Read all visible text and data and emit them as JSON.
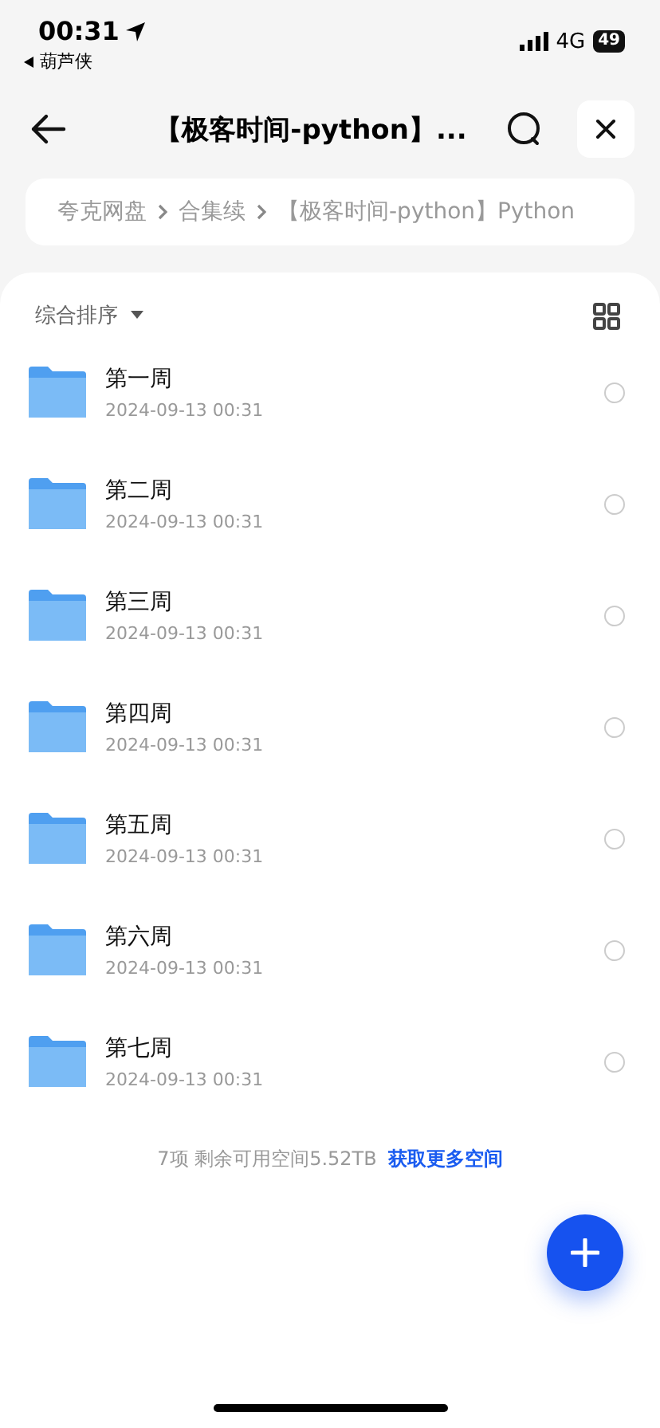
{
  "status_bar": {
    "time": "00:31",
    "back_app": "葫芦侠",
    "network": "4G",
    "battery": "49"
  },
  "header": {
    "title": "【极客时间-python】..."
  },
  "breadcrumb": [
    "夸克网盘",
    "合集续",
    "【极客时间-python】Python"
  ],
  "sort": {
    "label": "综合排序"
  },
  "items": [
    {
      "name": "第一周",
      "date": "2024-09-13 00:31",
      "selected": false
    },
    {
      "name": "第二周",
      "date": "2024-09-13 00:31",
      "selected": false
    },
    {
      "name": "第三周",
      "date": "2024-09-13 00:31",
      "selected": false
    },
    {
      "name": "第四周",
      "date": "2024-09-13 00:31",
      "selected": false
    },
    {
      "name": "第五周",
      "date": "2024-09-13 00:31",
      "selected": false
    },
    {
      "name": "第六周",
      "date": "2024-09-13 00:31",
      "selected": false
    },
    {
      "name": "第七周",
      "date": "2024-09-13 00:31",
      "selected": false
    }
  ],
  "footer": {
    "summary": "7项 剩余可用空间5.52TB",
    "link": "获取更多空间"
  }
}
